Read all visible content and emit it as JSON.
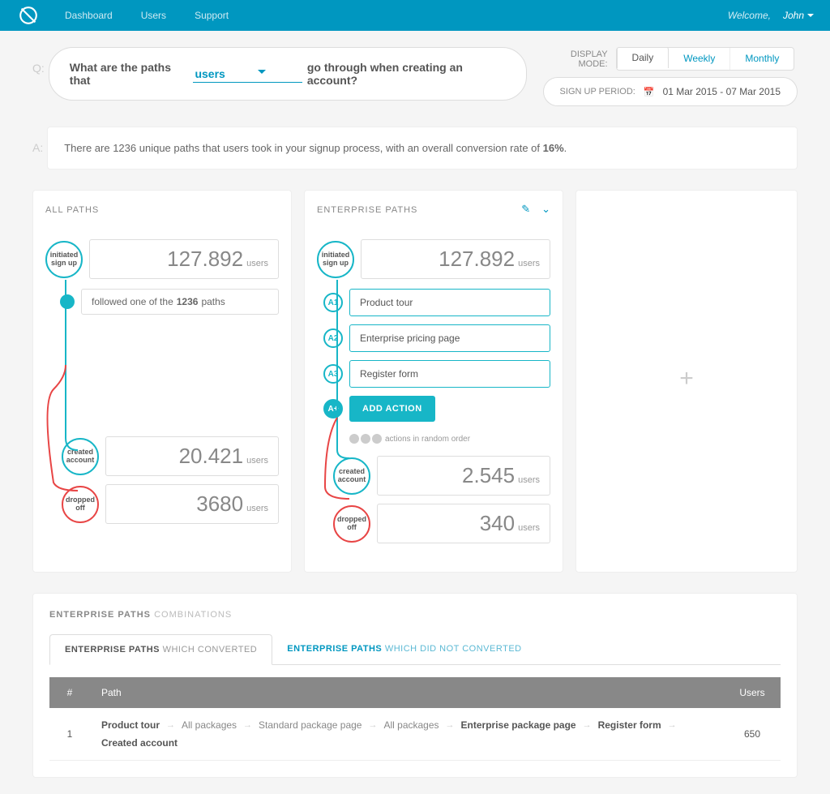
{
  "topbar": {
    "nav": [
      "Dashboard",
      "Users",
      "Support"
    ],
    "welcome": "Welcome,",
    "user": "John"
  },
  "question": {
    "prefix": "What are the paths that",
    "select": "users",
    "suffix": "go through when creating an account?"
  },
  "display": {
    "label": "DISPLAY MODE:",
    "tabs": [
      "Daily",
      "Weekly",
      "Monthly"
    ],
    "active": 0
  },
  "period": {
    "label": "SIGN UP PERIOD:",
    "dates": "01 Mar 2015 - 07 Mar 2015"
  },
  "answer": {
    "p1": "There are 1236 unique paths that users took in your signup process, with an overall conversion rate of ",
    "rate": "16%",
    "p2": "."
  },
  "allpaths": {
    "title": "ALL PATHS",
    "initiated_label": "initiated sign up",
    "initiated_num": "127.892",
    "initiated_unit": "users",
    "follow_pre": "followed one of the ",
    "follow_bold": "1236",
    "follow_post": " paths",
    "created_label": "created account",
    "created_num": "20.421",
    "created_unit": "users",
    "dropped_label": "dropped off",
    "dropped_num": "3680",
    "dropped_unit": "users"
  },
  "enterprise": {
    "title": "ENTERPRISE PATHS",
    "initiated_label": "initiated sign up",
    "initiated_num": "127.892",
    "initiated_unit": "users",
    "steps": [
      {
        "id": "A1",
        "label": "Product tour"
      },
      {
        "id": "A2",
        "label": "Enterprise pricing page"
      },
      {
        "id": "A3",
        "label": "Register form"
      }
    ],
    "add_id": "A+",
    "add_label": "ADD ACTION",
    "rand_note": "actions in random order",
    "created_label": "created account",
    "created_num": "2.545",
    "created_unit": "users",
    "dropped_label": "dropped off",
    "dropped_num": "340",
    "dropped_unit": "users"
  },
  "combos": {
    "title_bold": "ENTERPRISE PATHS",
    "title_light": "COMBINATIONS",
    "tab1_bold": "ENTERPRISE PATHS",
    "tab1_light": "WHICH CONVERTED",
    "tab2_bold": "ENTERPRISE PATHS",
    "tab2_light": "WHICH DID NOT CONVERTED",
    "th_num": "#",
    "th_path": "Path",
    "th_users": "Users",
    "row": {
      "num": "1",
      "users": "650",
      "chain": [
        "Product tour",
        "All packages",
        "Standard package page",
        "All packages",
        "Enterprise package page",
        "Register form",
        "Created account"
      ],
      "bold": [
        0,
        4,
        5,
        6
      ]
    }
  }
}
